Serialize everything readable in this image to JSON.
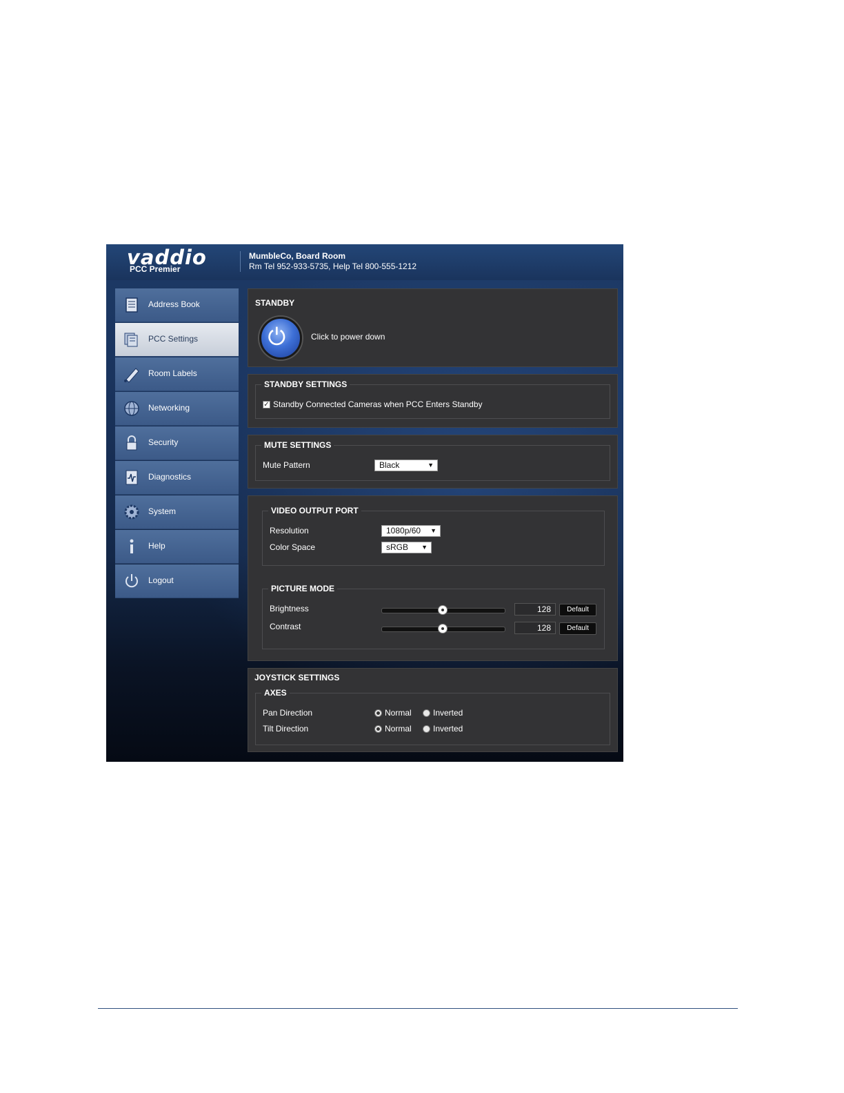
{
  "header": {
    "logo": "vaddio",
    "product": "PCC Premier",
    "room_name": "MumbleCo, Board Room",
    "room_tel": "Rm Tel 952-933-5735, Help Tel 800-555-1212"
  },
  "sidebar": {
    "items": [
      {
        "label": "Address Book",
        "icon": "address-book-icon"
      },
      {
        "label": "PCC Settings",
        "icon": "pcc-settings-icon",
        "active": true
      },
      {
        "label": "Room Labels",
        "icon": "room-labels-icon"
      },
      {
        "label": "Networking",
        "icon": "networking-icon"
      },
      {
        "label": "Security",
        "icon": "lock-icon"
      },
      {
        "label": "Diagnostics",
        "icon": "diagnostics-icon"
      },
      {
        "label": "System",
        "icon": "gear-icon"
      },
      {
        "label": "Help",
        "icon": "info-icon"
      },
      {
        "label": "Logout",
        "icon": "power-icon"
      }
    ]
  },
  "standby": {
    "title": "STANDBY",
    "action_text": "Click to power down"
  },
  "standby_settings": {
    "title": "STANDBY SETTINGS",
    "checkbox_label": "Standby Connected Cameras when PCC Enters Standby",
    "checked": true
  },
  "mute_settings": {
    "title": "MUTE SETTINGS",
    "pattern_label": "Mute Pattern",
    "pattern_value": "Black"
  },
  "video_output": {
    "title": "VIDEO OUTPUT PORT",
    "resolution_label": "Resolution",
    "resolution_value": "1080p/60",
    "color_space_label": "Color Space",
    "color_space_value": "sRGB"
  },
  "picture_mode": {
    "title": "PICTURE MODE",
    "brightness_label": "Brightness",
    "brightness_value": "128",
    "contrast_label": "Contrast",
    "contrast_value": "128",
    "default_label": "Default",
    "slider_max": 255
  },
  "joystick": {
    "title": "JOYSTICK SETTINGS",
    "axes_title": "AXES",
    "pan_label": "Pan Direction",
    "tilt_label": "Tilt Direction",
    "normal_label": "Normal",
    "inverted_label": "Inverted",
    "pan_selected": "Normal",
    "tilt_selected": "Normal"
  },
  "colors": {
    "accent_blue": "#3d6fd6",
    "panel_bg": "#333335",
    "nav_bg": "#4f6f9c"
  }
}
